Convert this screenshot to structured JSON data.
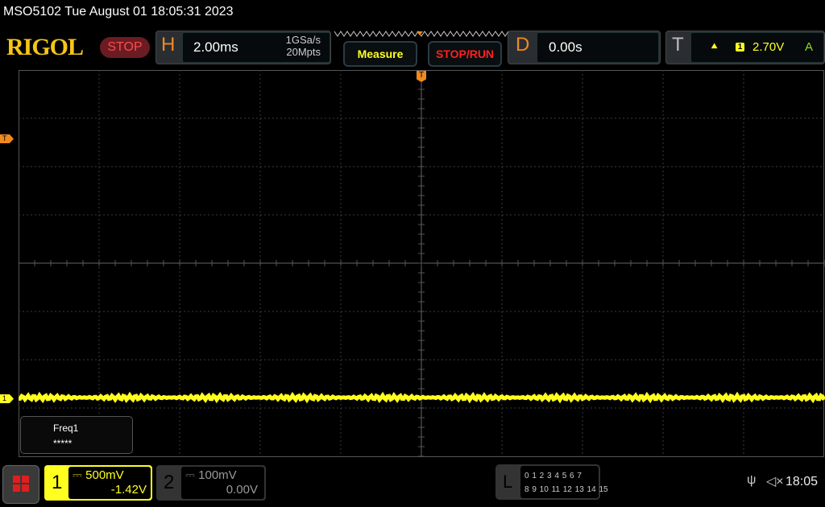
{
  "title": "MSO5102  Tue August 01 18:05:31 2023",
  "logo": "RIGOL",
  "run_status": "STOP",
  "horizontal": {
    "label": "H",
    "timebase": "2.00ms",
    "sample_rate": "1GSa/s",
    "memory_depth": "20Mpts"
  },
  "buttons": {
    "measure": "Measure",
    "stop_run": "STOP/RUN"
  },
  "delay": {
    "label": "D",
    "value": "0.00s"
  },
  "trigger": {
    "label": "T",
    "edge_icon": "rising-edge-icon",
    "source": "1",
    "level": "2.70V",
    "mode": "A"
  },
  "markers": {
    "trigger_level": "T",
    "channel1": "1",
    "trigger_position": "T"
  },
  "measurement": {
    "label": "Freq1",
    "value": "*****"
  },
  "channel1": {
    "number": "1",
    "scale": "500mV",
    "offset": "-1.42V",
    "color": "#ffff20"
  },
  "channel2": {
    "number": "2",
    "scale": "100mV",
    "offset": "0.00V"
  },
  "logic": {
    "label": "L",
    "row1": "0 1 2 3  4 5 6 7",
    "row2": "8 9 10 11 12 13 14 15"
  },
  "status": {
    "usb_icon": "usb-icon",
    "mute_icon": "speaker-muted-icon",
    "time": "18:05"
  },
  "colors": {
    "accent": "#f08a1e",
    "channel1": "#ffff20",
    "stop": "#ff2020"
  }
}
